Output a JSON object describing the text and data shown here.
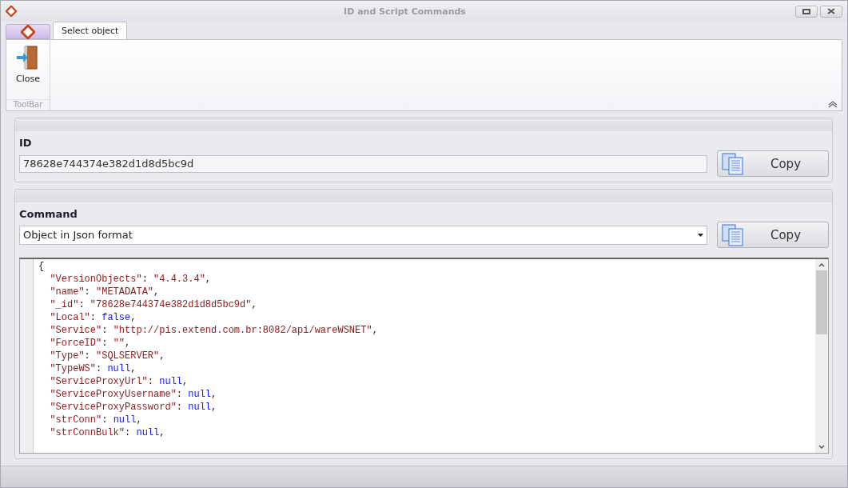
{
  "window": {
    "title": "ID and Script Commands"
  },
  "ribbon": {
    "tabs": [
      {
        "label": "Select object",
        "selected": true
      }
    ],
    "buttons": [
      {
        "label": "Close"
      }
    ],
    "group_label": "ToolBar"
  },
  "id_panel": {
    "label": "ID",
    "value": "78628e744374e382d1d8d5bc9d",
    "copy_button": "Copy"
  },
  "command_panel": {
    "label": "Command",
    "selected_option": "Object in Json format",
    "copy_button": "Copy",
    "code_lines": [
      [
        {
          "kind": "punct",
          "text": "{"
        }
      ],
      [
        {
          "kind": "key",
          "text": "  \"VersionObjects\""
        },
        {
          "kind": "punct",
          "text": ": "
        },
        {
          "kind": "string",
          "text": "\"4.4.3.4\""
        },
        {
          "kind": "punct",
          "text": ","
        }
      ],
      [
        {
          "kind": "key",
          "text": "  \"name\""
        },
        {
          "kind": "punct",
          "text": ": "
        },
        {
          "kind": "string",
          "text": "\"METADATA\""
        },
        {
          "kind": "punct",
          "text": ","
        }
      ],
      [
        {
          "kind": "key",
          "text": "  \"_id\""
        },
        {
          "kind": "punct",
          "text": ": "
        },
        {
          "kind": "string",
          "text": "\"78628e744374e382d1d8d5bc9d\""
        },
        {
          "kind": "punct",
          "text": ","
        }
      ],
      [
        {
          "kind": "key",
          "text": "  \"Local\""
        },
        {
          "kind": "punct",
          "text": ": "
        },
        {
          "kind": "literal",
          "text": "false"
        },
        {
          "kind": "punct",
          "text": ","
        }
      ],
      [
        {
          "kind": "key",
          "text": "  \"Service\""
        },
        {
          "kind": "punct",
          "text": ": "
        },
        {
          "kind": "string",
          "text": "\"http://pis.extend.com.br:8082/api/wareWSNET\""
        },
        {
          "kind": "punct",
          "text": ","
        }
      ],
      [
        {
          "kind": "key",
          "text": "  \"ForceID\""
        },
        {
          "kind": "punct",
          "text": ": "
        },
        {
          "kind": "string",
          "text": "\"\""
        },
        {
          "kind": "punct",
          "text": ","
        }
      ],
      [
        {
          "kind": "key",
          "text": "  \"Type\""
        },
        {
          "kind": "punct",
          "text": ": "
        },
        {
          "kind": "string",
          "text": "\"SQLSERVER\""
        },
        {
          "kind": "punct",
          "text": ","
        }
      ],
      [
        {
          "kind": "key",
          "text": "  \"TypeWS\""
        },
        {
          "kind": "punct",
          "text": ": "
        },
        {
          "kind": "literal",
          "text": "null"
        },
        {
          "kind": "punct",
          "text": ","
        }
      ],
      [
        {
          "kind": "key",
          "text": "  \"ServiceProxyUrl\""
        },
        {
          "kind": "punct",
          "text": ": "
        },
        {
          "kind": "literal",
          "text": "null"
        },
        {
          "kind": "punct",
          "text": ","
        }
      ],
      [
        {
          "kind": "key",
          "text": "  \"ServiceProxyUsername\""
        },
        {
          "kind": "punct",
          "text": ": "
        },
        {
          "kind": "literal",
          "text": "null"
        },
        {
          "kind": "punct",
          "text": ","
        }
      ],
      [
        {
          "kind": "key",
          "text": "  \"ServiceProxyPassword\""
        },
        {
          "kind": "punct",
          "text": ": "
        },
        {
          "kind": "literal",
          "text": "null"
        },
        {
          "kind": "punct",
          "text": ","
        }
      ],
      [
        {
          "kind": "key",
          "text": "  \"strConn\""
        },
        {
          "kind": "punct",
          "text": ": "
        },
        {
          "kind": "literal",
          "text": "null"
        },
        {
          "kind": "punct",
          "text": ","
        }
      ],
      [
        {
          "kind": "key",
          "text": "  \"strConnBulk\""
        },
        {
          "kind": "punct",
          "text": ": "
        },
        {
          "kind": "literal",
          "text": "null"
        },
        {
          "kind": "punct",
          "text": ","
        }
      ]
    ]
  }
}
